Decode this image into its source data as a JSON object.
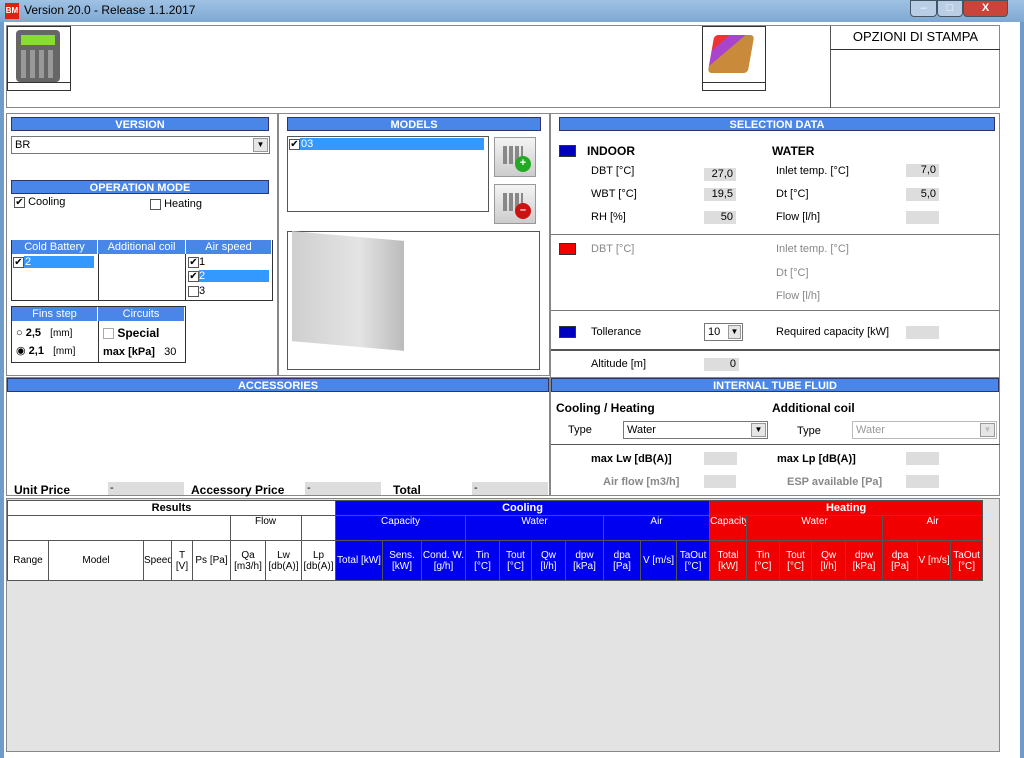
{
  "window": {
    "title": "Version 20.0 - Release 1.1.2017",
    "logo": "BM",
    "buttons": [
      "minimize",
      "maximize",
      "close"
    ],
    "close_label": "X"
  },
  "toolbar": {
    "calculator_icon": "calculator-icon",
    "folder_icon": "folder-icon",
    "print_options": "OPZIONI DI STAMPA"
  },
  "version": {
    "header": "VERSION",
    "value": "BR"
  },
  "operation_mode": {
    "header": "OPERATION MODE",
    "cooling": {
      "label": "Cooling",
      "checked": true
    },
    "heating": {
      "label": "Heating",
      "checked": false
    }
  },
  "lists": {
    "cold_battery": {
      "header": "Cold Battery",
      "items": [
        {
          "label": "2",
          "checked": true
        }
      ]
    },
    "additional_coil": {
      "header": "Additional coil"
    },
    "air_speed": {
      "header": "Air speed",
      "items": [
        {
          "label": "1",
          "checked": true
        },
        {
          "label": "2",
          "checked": true
        },
        {
          "label": "3",
          "checked": false
        }
      ]
    }
  },
  "fins": {
    "header": "Fins step",
    "options": [
      {
        "value": "2,5",
        "unit": "[mm]",
        "selected": false
      },
      {
        "value": "2,1",
        "unit": "[mm]",
        "selected": true
      }
    ]
  },
  "circuits": {
    "header": "Circuits",
    "special": "Special",
    "max_label": "max [kPa]",
    "max_value": "30"
  },
  "models": {
    "header": "MODELS",
    "items": [
      {
        "label": "03",
        "checked": true
      }
    ]
  },
  "selection": {
    "header": "SELECTION DATA",
    "indoor": "INDOOR",
    "water": "WATER",
    "dbt": "DBT [°C]",
    "dbt_val": "27,0",
    "wbt": "WBT [°C]",
    "wbt_val": "19,5",
    "rh": "RH [%]",
    "rh_val": "50",
    "inlet": "Inlet temp. [°C]",
    "inlet_val": "7,0",
    "dt": "Dt [°C]",
    "dt_val": "5,0",
    "flow": "Flow [l/h]",
    "h_dbt": "DBT [°C]",
    "h_inlet": "Inlet temp. [°C]",
    "h_dt": "Dt [°C]",
    "h_flow": "Flow [l/h]",
    "tolerance": "Tollerance",
    "tolerance_val": "10",
    "required": "Required capacity [kW]",
    "altitude": "Altitude [m]",
    "altitude_val": "0",
    "colors": {
      "cooling": "#0000c0",
      "heating": "#f00000"
    }
  },
  "fluid": {
    "header": "INTERNAL TUBE FLUID",
    "cooling_heating": "Cooling / Heating",
    "additional": "Additional coil",
    "type": "Type",
    "type_val": "Water",
    "type2_val": "Water",
    "max_lw": "max Lw [dB(A)]",
    "max_lp": "max Lp [dB(A)]",
    "air_flow": "Air flow [m3/h]",
    "esp": "ESP available [Pa]"
  },
  "accessories": {
    "header": "ACCESSORIES"
  },
  "prices": {
    "unit": "Unit Price",
    "unit_val": "-",
    "accessory": "Accessory Price",
    "accessory_val": "-",
    "total": "Total",
    "total_val": "-"
  },
  "results": {
    "groups": [
      "Results",
      "Cooling",
      "Heating"
    ],
    "sub": [
      "Flow",
      "Capacity",
      "Water",
      "Air",
      "Capacity",
      "Water",
      "Air"
    ],
    "columns": [
      "Range",
      "Model",
      "Speed",
      "T [V]",
      "Ps [Pa]",
      "Qa [m3/h]",
      "Lw [db(A)]",
      "Lp [db(A)]",
      "Total [kW]",
      "Sens. [kW]",
      "Cond. W. [g/h]",
      "Tin [°C]",
      "Tout [°C]",
      "Qw [l/h]",
      "dpw [kPa]",
      "dpa [Pa]",
      "V [m/s]",
      "TaOut [°C]",
      "Total [kW]",
      "Tin [°C]",
      "Tout [°C]",
      "Qw [l/h]",
      "dpw [kPa]",
      "dpa [Pa]",
      "V [m/s]",
      "TaOut [°C]"
    ]
  }
}
